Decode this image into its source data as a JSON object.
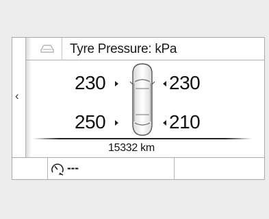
{
  "header": {
    "title": "Tyre Pressure: kPa",
    "car_icon": "car-icon",
    "back_icon": "chevron-left-icon"
  },
  "tyres": {
    "front_left": "230",
    "front_right": "230",
    "rear_left": "250",
    "rear_right": "210"
  },
  "odometer": "15332 km",
  "bottom_bar": {
    "speed_icon": "speed-limiter-icon",
    "speed_value": "---"
  }
}
